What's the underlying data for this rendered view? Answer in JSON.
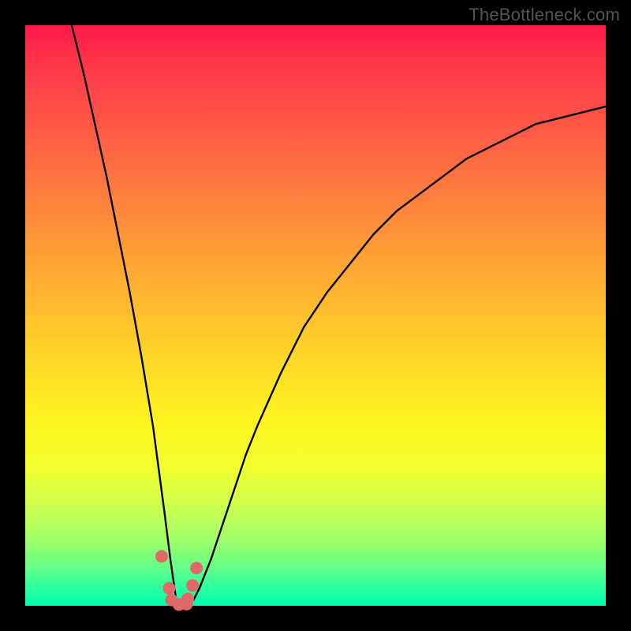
{
  "watermark": "TheBottleneck.com",
  "chart_data": {
    "type": "line",
    "title": "",
    "xlabel": "",
    "ylabel": "",
    "xlim": [
      0,
      100
    ],
    "ylim": [
      0,
      100
    ],
    "note": "Bottleneck curve: sharp V with minimum near x≈26; values are percent of vertical span (0=bottom/green, 100=top/red). Estimated from pixel positions.",
    "series": [
      {
        "name": "bottleneck-curve",
        "x": [
          8,
          10,
          12,
          14,
          16,
          18,
          20,
          22,
          24,
          25,
          26,
          27,
          28,
          29,
          30,
          32,
          34,
          36,
          38,
          40,
          44,
          48,
          52,
          56,
          60,
          64,
          68,
          72,
          76,
          80,
          84,
          88,
          92,
          96,
          100
        ],
        "y": [
          100,
          92,
          83,
          74,
          64,
          54,
          43,
          31,
          16,
          8,
          1,
          0,
          0,
          1,
          3,
          8,
          14,
          20,
          26,
          31,
          40,
          48,
          54,
          59,
          64,
          68,
          71,
          74,
          77,
          79,
          81,
          83,
          84,
          85,
          86
        ]
      }
    ],
    "markers": {
      "name": "highlight-points",
      "x": [
        23.5,
        24.8,
        25.2,
        26.5,
        27.8,
        28.0,
        28.8,
        29.5
      ],
      "y": [
        8.5,
        3.0,
        1.0,
        0.2,
        0.3,
        1.2,
        3.5,
        6.5
      ],
      "color": "#e06868",
      "radius_px": 8
    }
  },
  "colors": {
    "curve_stroke": "#000000",
    "marker_fill": "#e06868",
    "frame_bg": "#000000",
    "watermark": "#545454"
  }
}
